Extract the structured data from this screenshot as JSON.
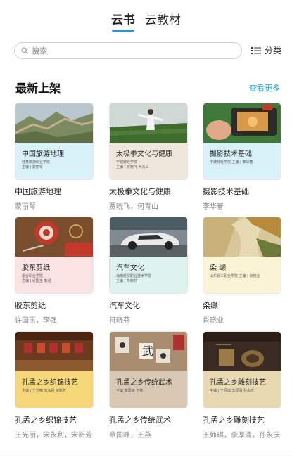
{
  "tabs": [
    {
      "label": "云书",
      "active": true
    },
    {
      "label": "云教材",
      "active": false
    }
  ],
  "search": {
    "placeholder": "搜索"
  },
  "category": {
    "label": "分类",
    "icon": "list-icon"
  },
  "section": {
    "title": "最新上架",
    "more": "查看更多"
  },
  "accent_color": "#1e9bd7",
  "books": [
    {
      "title": "中国旅游地理",
      "author": "蒙丽琴",
      "cover_title": "中国旅游地理",
      "cover_sub": [
        "桂林旅游职业学院",
        "主编 | 蒙丽琴"
      ],
      "band_color": "#d9f1f9",
      "scene": "great-wall-photo"
    },
    {
      "title": "太极拳文化与健康",
      "author": "贾晓飞，何青山",
      "cover_title": "太极拳文化与健康",
      "cover_sub": [
        "宁波财经学院",
        "主编 | 贾晓飞  何青山"
      ],
      "band_color": "#efe6dc",
      "scene": "tai-chi-photo"
    },
    {
      "title": "摄影技术基础",
      "author": "李华春",
      "cover_title": "摄影技术基础",
      "cover_sub": [
        "宁波财经学院  主编 | 李华春"
      ],
      "band_color": "#d9f1f9",
      "scene": "camera-photo"
    },
    {
      "title": "胶东剪纸",
      "author": "许国玉，李强",
      "cover_title": "胶东剪纸",
      "cover_sub": [
        "烟台职业学院",
        "主编 | 许国玉  李强"
      ],
      "band_color": "#fbe3e3",
      "scene": "paper-cut-photo"
    },
    {
      "title": "汽车文化",
      "author": "符晓芬",
      "cover_title": "汽车文化",
      "cover_sub": [
        "海南经贸职业技术学院",
        "主编 | 符晓芬"
      ],
      "band_color": "#dff3ee",
      "scene": "car-photo"
    },
    {
      "title": "染缬",
      "author": "肖晓业",
      "cover_title": "染    缬",
      "cover_sub": [
        "山东轻工职业学院    主编 | 肖晓业"
      ],
      "band_color": "#fbf3d6",
      "scene": "dyed-fabric-photo"
    },
    {
      "title": "孔孟之乡织锦技艺",
      "author": "王光丽，宋永利，宋新芳",
      "cover_title": "孔孟之乡织锦技艺",
      "cover_sub": [
        "主编 | 王光丽    宋永利    宋新芳"
      ],
      "band_color": "#f5d77a",
      "scene": "brocade-photo"
    },
    {
      "title": "孔孟之乡传统武术",
      "author": "章国峰，王燕",
      "cover_title": "孔孟之乡传统武术",
      "cover_sub": [
        "主编    章国峰    王燕"
      ],
      "band_color": "#d9c9b4",
      "scene": "martial-arts-photo"
    },
    {
      "title": "孔孟之乡雕刻技艺",
      "author": "王师琪，李厚清，孙永庆",
      "cover_title": "孔孟之乡雕刻技艺",
      "cover_sub": [
        "主编 | 王师琪    李厚清    孙永庆"
      ],
      "band_color": "#e9d9b3",
      "scene": "carving-photo"
    }
  ]
}
